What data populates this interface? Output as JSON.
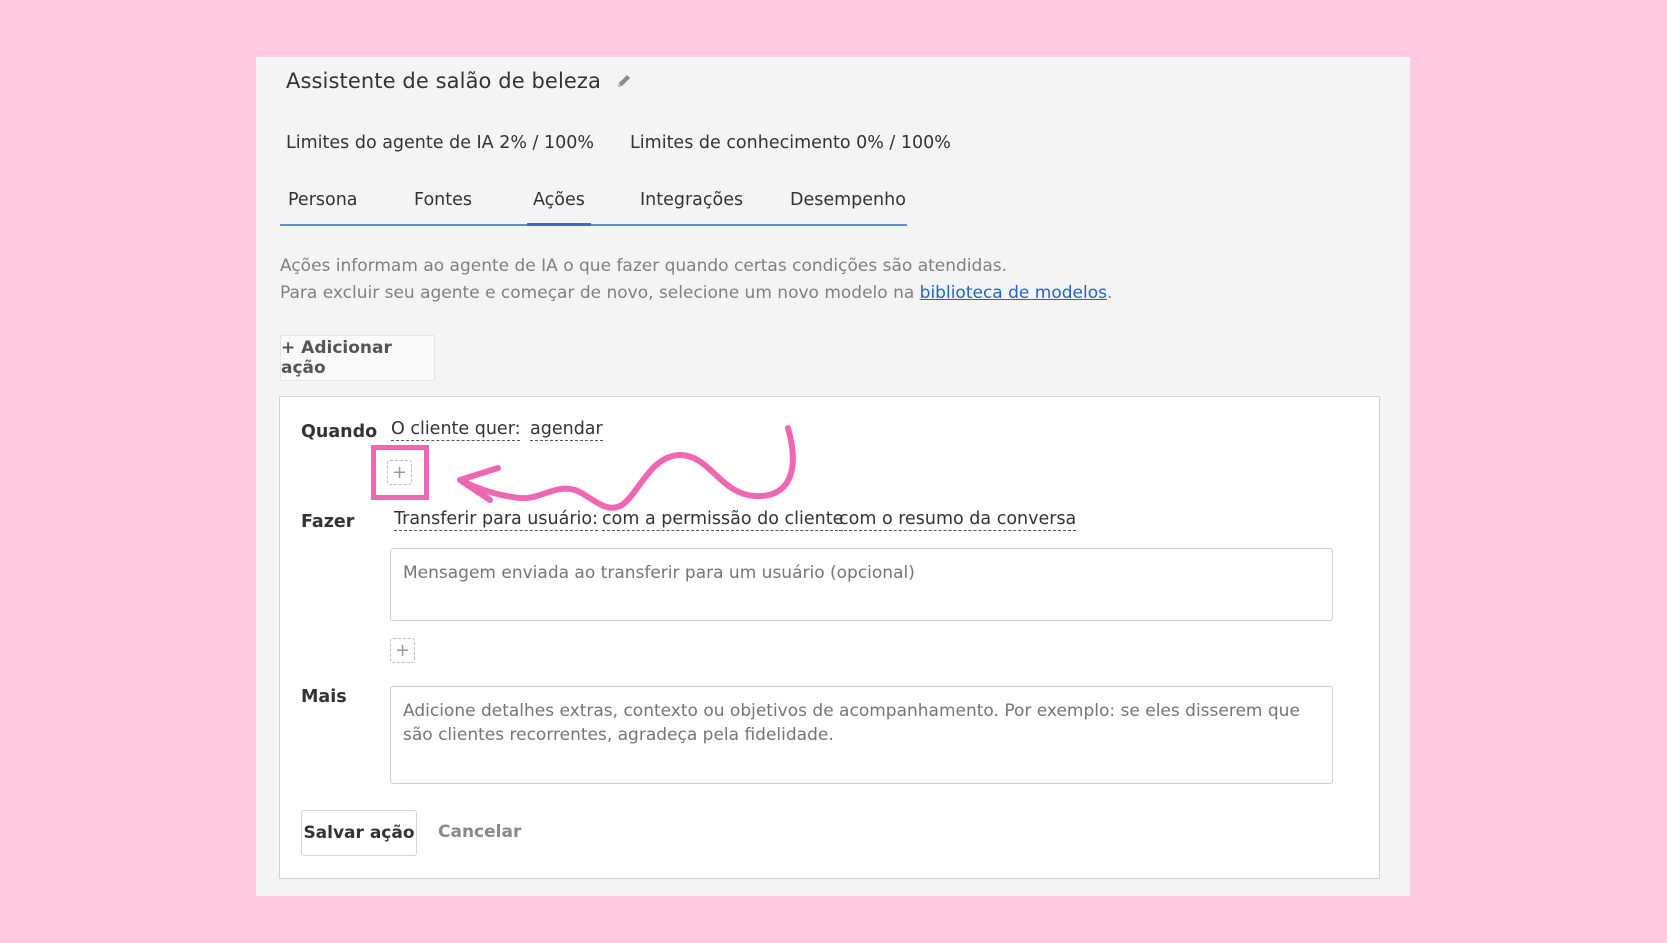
{
  "agent": {
    "title": "Assistente de salão de beleza",
    "edit_icon": "pencil-icon"
  },
  "limits": {
    "ai_agent": "Limites do agente de IA 2% / 100%",
    "knowledge": "Limites de conhecimento 0% / 100%"
  },
  "tabs": [
    {
      "label": "Persona",
      "active": false
    },
    {
      "label": "Fontes",
      "active": false
    },
    {
      "label": "Ações",
      "active": true
    },
    {
      "label": "Integrações",
      "active": false
    },
    {
      "label": "Desempenho",
      "active": false
    }
  ],
  "description": {
    "line1": "Ações informam ao agente de IA o que fazer quando certas condições são atendidas.",
    "line2_prefix": "Para excluir seu agente e começar de novo, selecione um novo modelo na ",
    "link": "biblioteca de modelos",
    "line2_suffix": "."
  },
  "add_action_label": "+ Adicionar ação",
  "action": {
    "when_label": "Quando",
    "when_condition": "O cliente quer:",
    "when_value": "agendar",
    "do_label": "Fazer",
    "do_action": "Transferir para usuário:",
    "do_option1": "com a permissão do cliente",
    "do_option2": "com o resumo da conversa",
    "message_placeholder": "Mensagem enviada ao transferir para um usuário (opcional)",
    "more_label": "Mais",
    "more_placeholder": "Adicione detalhes extras, contexto ou objetivos de acompanhamento. Por exemplo: se eles disserem que são clientes recorrentes, agradeça pela fidelidade.",
    "plus_symbol": "+",
    "save_label": "Salvar ação",
    "cancel_label": "Cancelar"
  },
  "colors": {
    "background": "#ffc9e1",
    "annotation": "#ef66b3",
    "tab_underline": "#2f6fcc",
    "link": "#1c65c7"
  }
}
